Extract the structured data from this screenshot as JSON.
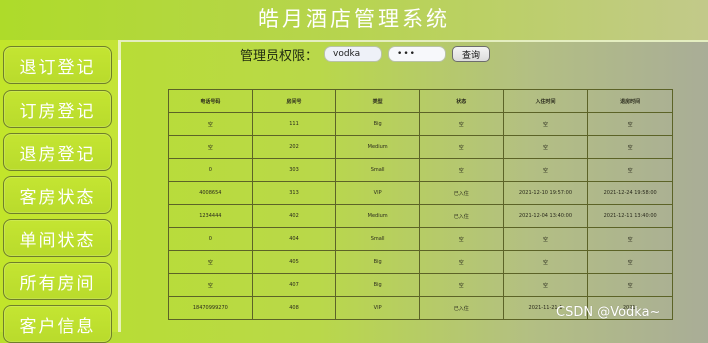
{
  "app": {
    "title": "皓月酒店管理系统"
  },
  "sidebar": {
    "items": [
      {
        "label": "退订登记"
      },
      {
        "label": "订房登记"
      },
      {
        "label": "退房登记"
      },
      {
        "label": "客房状态"
      },
      {
        "label": "单间状态"
      },
      {
        "label": "所有房间"
      },
      {
        "label": "客户信息"
      }
    ]
  },
  "search": {
    "admin_label": "管理员权限：",
    "username_value": "vodka",
    "password_value": "•••",
    "query_label": "查询"
  },
  "table": {
    "headers": [
      "电话号码",
      "房间号",
      "类型",
      "状态",
      "入住时间",
      "退房时间"
    ],
    "rows": [
      [
        "空",
        "111",
        "Big",
        "空",
        "空",
        "空"
      ],
      [
        "空",
        "202",
        "Medium",
        "空",
        "空",
        "空"
      ],
      [
        "0",
        "303",
        "Small",
        "空",
        "空",
        "空"
      ],
      [
        "4008654",
        "313",
        "VIP",
        "已入住",
        "2021-12-10 19:57:00",
        "2021-12-24 19:58:00"
      ],
      [
        "1234444",
        "402",
        "Medium",
        "已入住",
        "2021-12-04 13:40:00",
        "2021-12-11 13:40:00"
      ],
      [
        "0",
        "404",
        "Small",
        "空",
        "空",
        "空"
      ],
      [
        "空",
        "405",
        "Big",
        "空",
        "空",
        "空"
      ],
      [
        "空",
        "407",
        "Big",
        "空",
        "空",
        "空"
      ],
      [
        "18470999270",
        "408",
        "VIP",
        "已入住",
        "2021-11-21 1",
        "2021-"
      ]
    ]
  },
  "watermark": "CSDN @Vodka~"
}
